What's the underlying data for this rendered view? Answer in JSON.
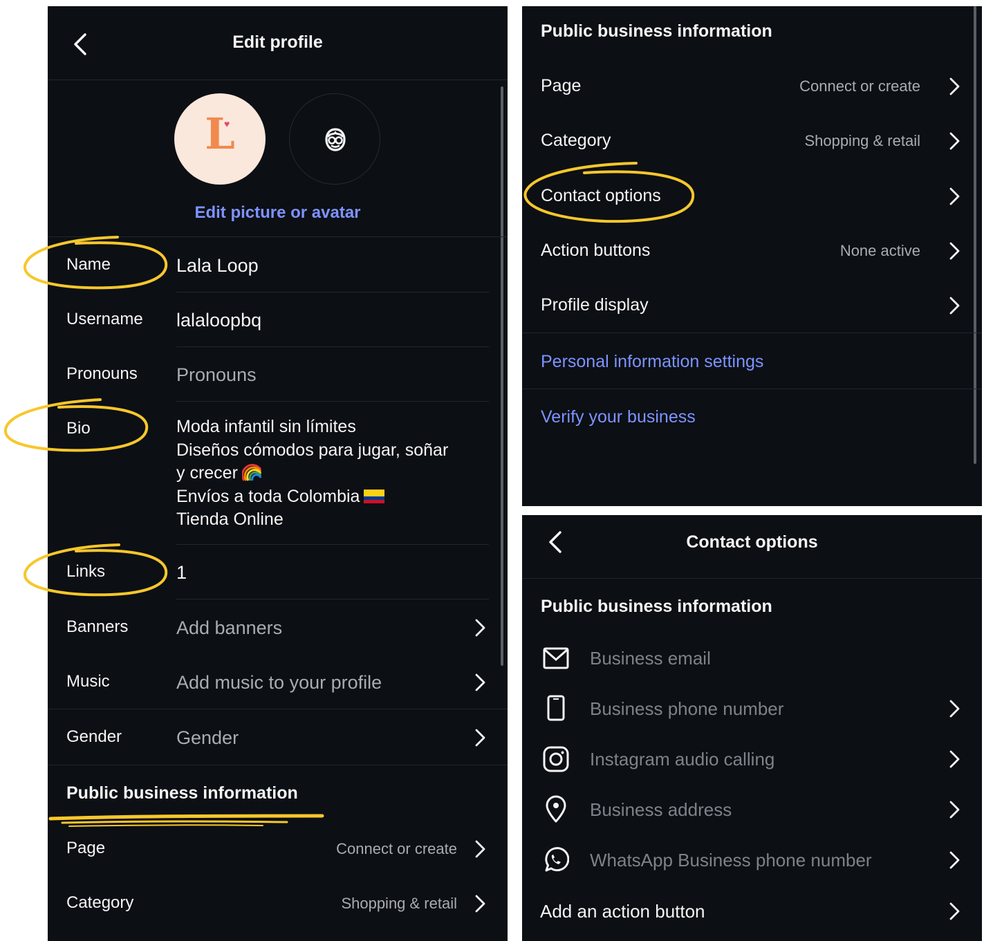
{
  "edit_profile": {
    "title": "Edit profile",
    "edit_picture_link": "Edit picture or avatar",
    "fields": {
      "name": {
        "label": "Name",
        "value": "Lala Loop"
      },
      "username": {
        "label": "Username",
        "value": "lalaloopbq"
      },
      "pronouns": {
        "label": "Pronouns",
        "placeholder": "Pronouns"
      },
      "bio": {
        "label": "Bio",
        "lines": [
          "Moda infantil sin límites",
          "Diseños cómodos para jugar, soñar",
          "y crecer",
          "Envíos a toda Colombia",
          "Tienda Online"
        ]
      },
      "links": {
        "label": "Links",
        "value": "1"
      },
      "banners": {
        "label": "Banners",
        "value": "Add banners"
      },
      "music": {
        "label": "Music",
        "value": "Add music to your profile"
      },
      "gender": {
        "label": "Gender",
        "value": "Gender"
      }
    },
    "business_section": {
      "title": "Public business information",
      "rows": [
        {
          "label": "Page",
          "value": "Connect or create"
        },
        {
          "label": "Category",
          "value": "Shopping & retail"
        }
      ]
    }
  },
  "business_info": {
    "title": "Public business information",
    "rows": [
      {
        "label": "Page",
        "value": "Connect or create"
      },
      {
        "label": "Category",
        "value": "Shopping & retail"
      },
      {
        "label": "Contact options",
        "value": ""
      },
      {
        "label": "Action buttons",
        "value": "None active"
      },
      {
        "label": "Profile display",
        "value": ""
      }
    ],
    "links": [
      "Personal information settings",
      "Verify your business"
    ]
  },
  "contact_options": {
    "title": "Contact options",
    "section_title": "Public business information",
    "items": [
      {
        "label": "Business email",
        "icon": "mail-icon"
      },
      {
        "label": "Business phone number",
        "icon": "phone-icon"
      },
      {
        "label": "Instagram audio calling",
        "icon": "instagram-icon"
      },
      {
        "label": "Business address",
        "icon": "location-pin-icon"
      },
      {
        "label": "WhatsApp Business phone number",
        "icon": "whatsapp-icon"
      }
    ],
    "add_action_button": "Add an action button"
  },
  "colors": {
    "background": "#0c0f14",
    "link_blue": "#7d93ff",
    "annotation_yellow": "#f7c72b"
  }
}
